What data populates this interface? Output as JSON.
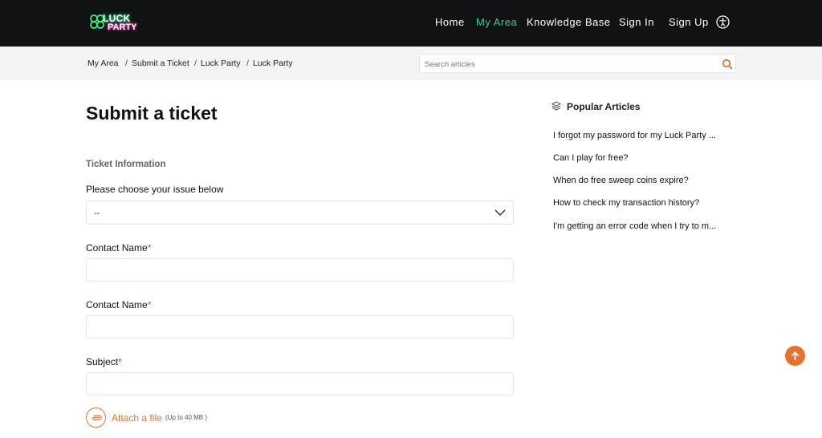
{
  "brand": {
    "logo_top": "LUCK",
    "logo_bottom": "PARTY"
  },
  "nav": {
    "home": "Home",
    "my_area": "My Area",
    "knowledge_base": "Knowledge Base",
    "sign_in": "Sign In",
    "sign_up": "Sign Up"
  },
  "breadcrumb": {
    "items": [
      "My Area",
      "Submit a Ticket",
      "Luck Party",
      "Luck Party"
    ],
    "separator": "/"
  },
  "search": {
    "placeholder": "Search articles"
  },
  "form": {
    "title": "Submit a ticket",
    "section": "Ticket Information",
    "issue_label": "Please choose your issue below",
    "issue_value": "--",
    "contact_name_label_1": "Contact Name",
    "contact_name_label_2": "Contact Name",
    "subject_label": "Subject",
    "required_mark": "*",
    "attach_label": "Attach a file",
    "attach_note": "(Up to 40 MB )"
  },
  "popular": {
    "title": "Popular Articles",
    "items": [
      "I forgot my password for my Luck Party ...",
      "Can I play for free?",
      "When do free sweep coins expire?",
      "How to check my transaction history?",
      "I'm getting an error code when I try to m..."
    ]
  },
  "colors": {
    "accent": "#e8722c",
    "nav_active": "#2ecc9a",
    "topbar": "#111213",
    "required": "#e0442a"
  },
  "icons": [
    "clover-logo-icon",
    "accessibility-icon",
    "search-icon",
    "chevron-down-icon",
    "layers-icon",
    "paperclip-icon",
    "arrow-up-icon"
  ]
}
